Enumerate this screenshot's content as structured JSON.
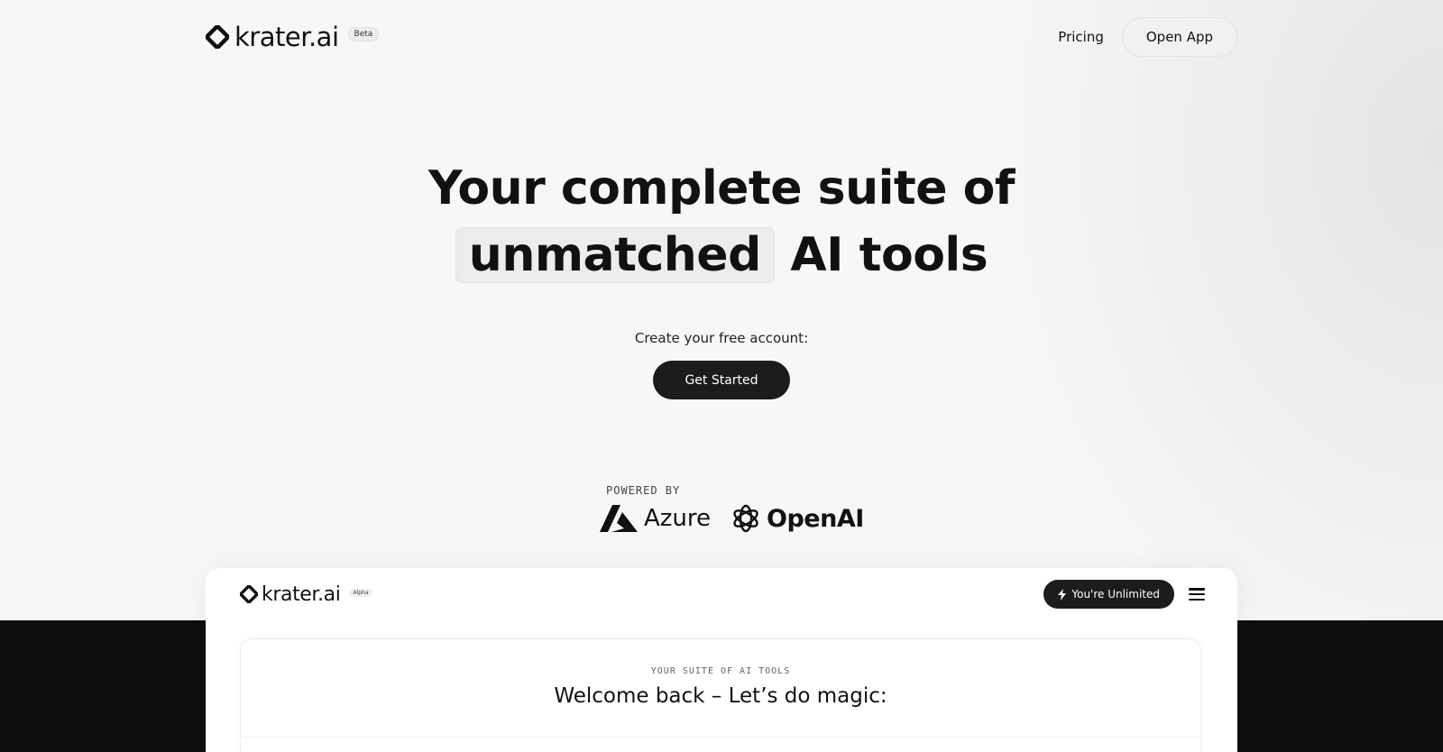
{
  "header": {
    "brand": "krater.ai",
    "badge": "Beta",
    "nav": {
      "pricing": "Pricing",
      "open_app": "Open App"
    }
  },
  "hero": {
    "title_line1": "Your complete suite of",
    "title_highlight": "unmatched",
    "title_line2_rest": "AI tools",
    "cta_label": "Create your free account:",
    "cta_button": "Get Started"
  },
  "powered": {
    "label": "POWERED BY",
    "partners": [
      {
        "name": "Azure",
        "icon": "azure-logo-icon"
      },
      {
        "name": "OpenAI",
        "icon": "openai-logo-icon"
      }
    ]
  },
  "preview": {
    "brand": "krater.ai",
    "badge": "Alpha",
    "status_button": "You're Unlimited",
    "status_icon": "lightning-icon",
    "menu_icon": "hamburger-menu-icon",
    "eyebrow": "YOUR SUITE OF AI TOOLS",
    "welcome": "Welcome back – Let’s do magic:"
  },
  "colors": {
    "background": "#f7f7f7",
    "primary_button": "#1c1c1c",
    "dark_band": "#0f0f10",
    "highlight": "#ececec"
  }
}
